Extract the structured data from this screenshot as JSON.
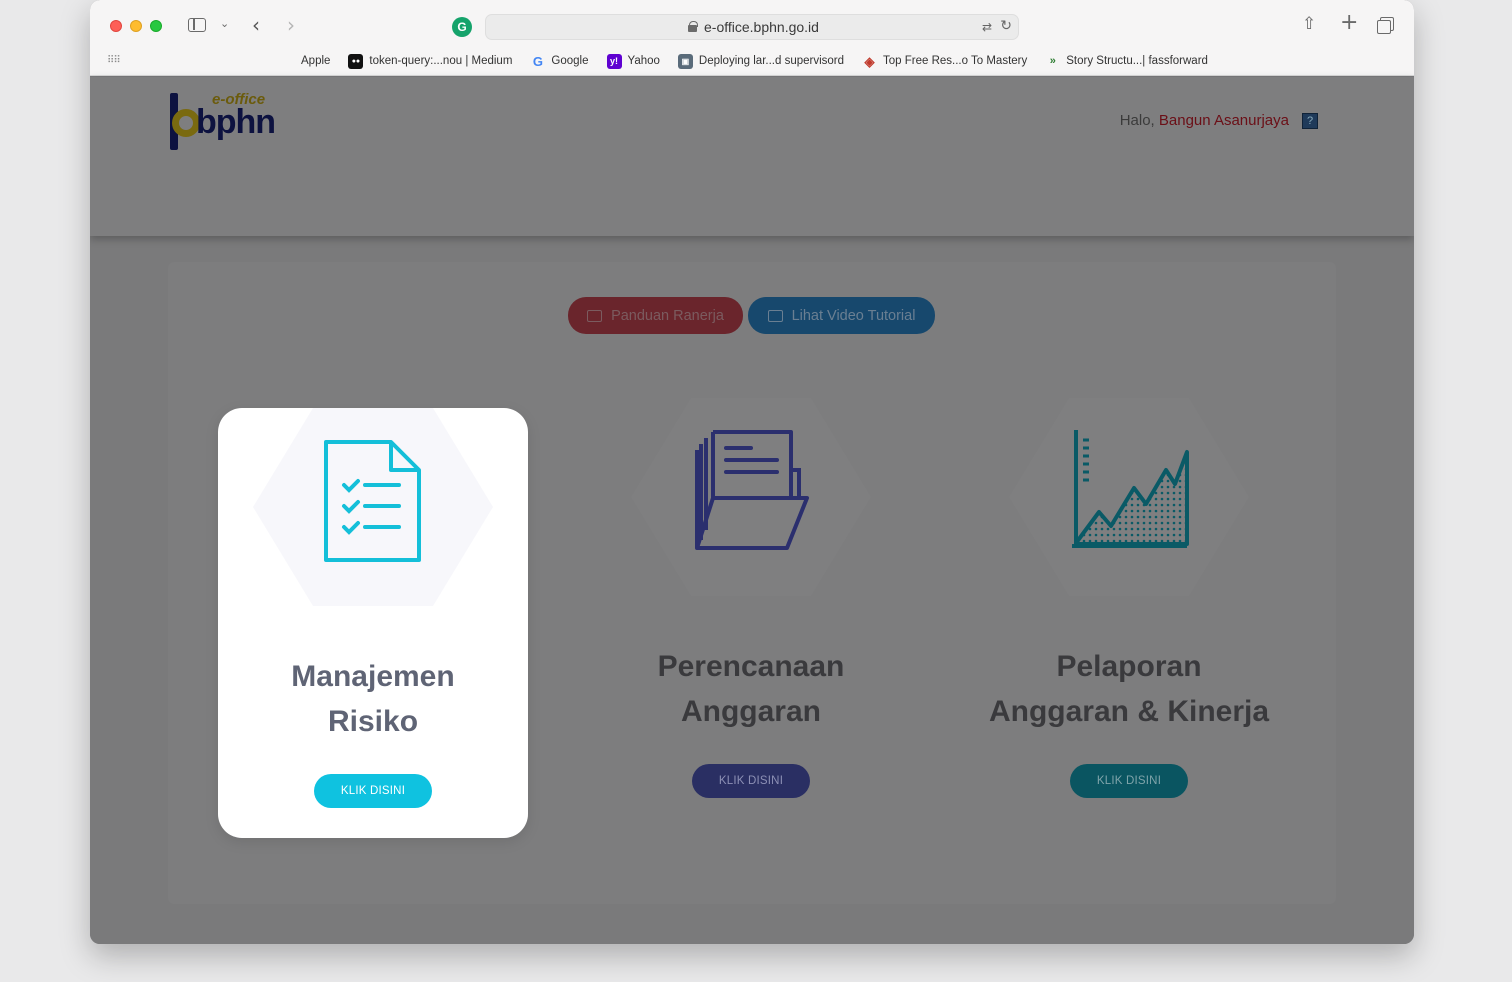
{
  "browser": {
    "url": "e-office.bphn.go.id",
    "bookmarks": [
      {
        "label": "Apple",
        "icon": "apple-icon"
      },
      {
        "label": "token-query:...nou | Medium",
        "icon": "medium-icon"
      },
      {
        "label": "Google",
        "icon": "google-icon"
      },
      {
        "label": "Yahoo",
        "icon": "yahoo-icon"
      },
      {
        "label": "Deploying lar...d supervisord",
        "icon": "deploy-icon"
      },
      {
        "label": "Top Free Res...o To Mastery",
        "icon": "ztm-icon"
      },
      {
        "label": "Story Structu...| fassforward",
        "icon": "story-icon"
      }
    ]
  },
  "header": {
    "logo_small": "e-office",
    "logo_main": "bphn",
    "greeting_prefix": "Halo,",
    "user_name": "Bangun Asanurjaya",
    "help_glyph": "?"
  },
  "actions": {
    "guide_label": "Panduan Ranerja",
    "video_label": "Lihat Video Tutorial"
  },
  "cards": [
    {
      "title_line1": "Manajemen",
      "title_line2": "Risiko",
      "button": "KLIK DISINI",
      "button_color": "#0fc2e0",
      "icon_color": "#14bfd9"
    },
    {
      "title_line1": "Perencanaan",
      "title_line2": "Anggaran",
      "button": "KLIK DISINI",
      "button_color": "#2a2f63",
      "icon_color": "#2b2f6e"
    },
    {
      "title_line1": "Pelaporan",
      "title_line2": "Anggaran & Kinerja",
      "button": "KLIK DISINI",
      "button_color": "#0a5561",
      "icon_color": "#0a5a66"
    }
  ]
}
